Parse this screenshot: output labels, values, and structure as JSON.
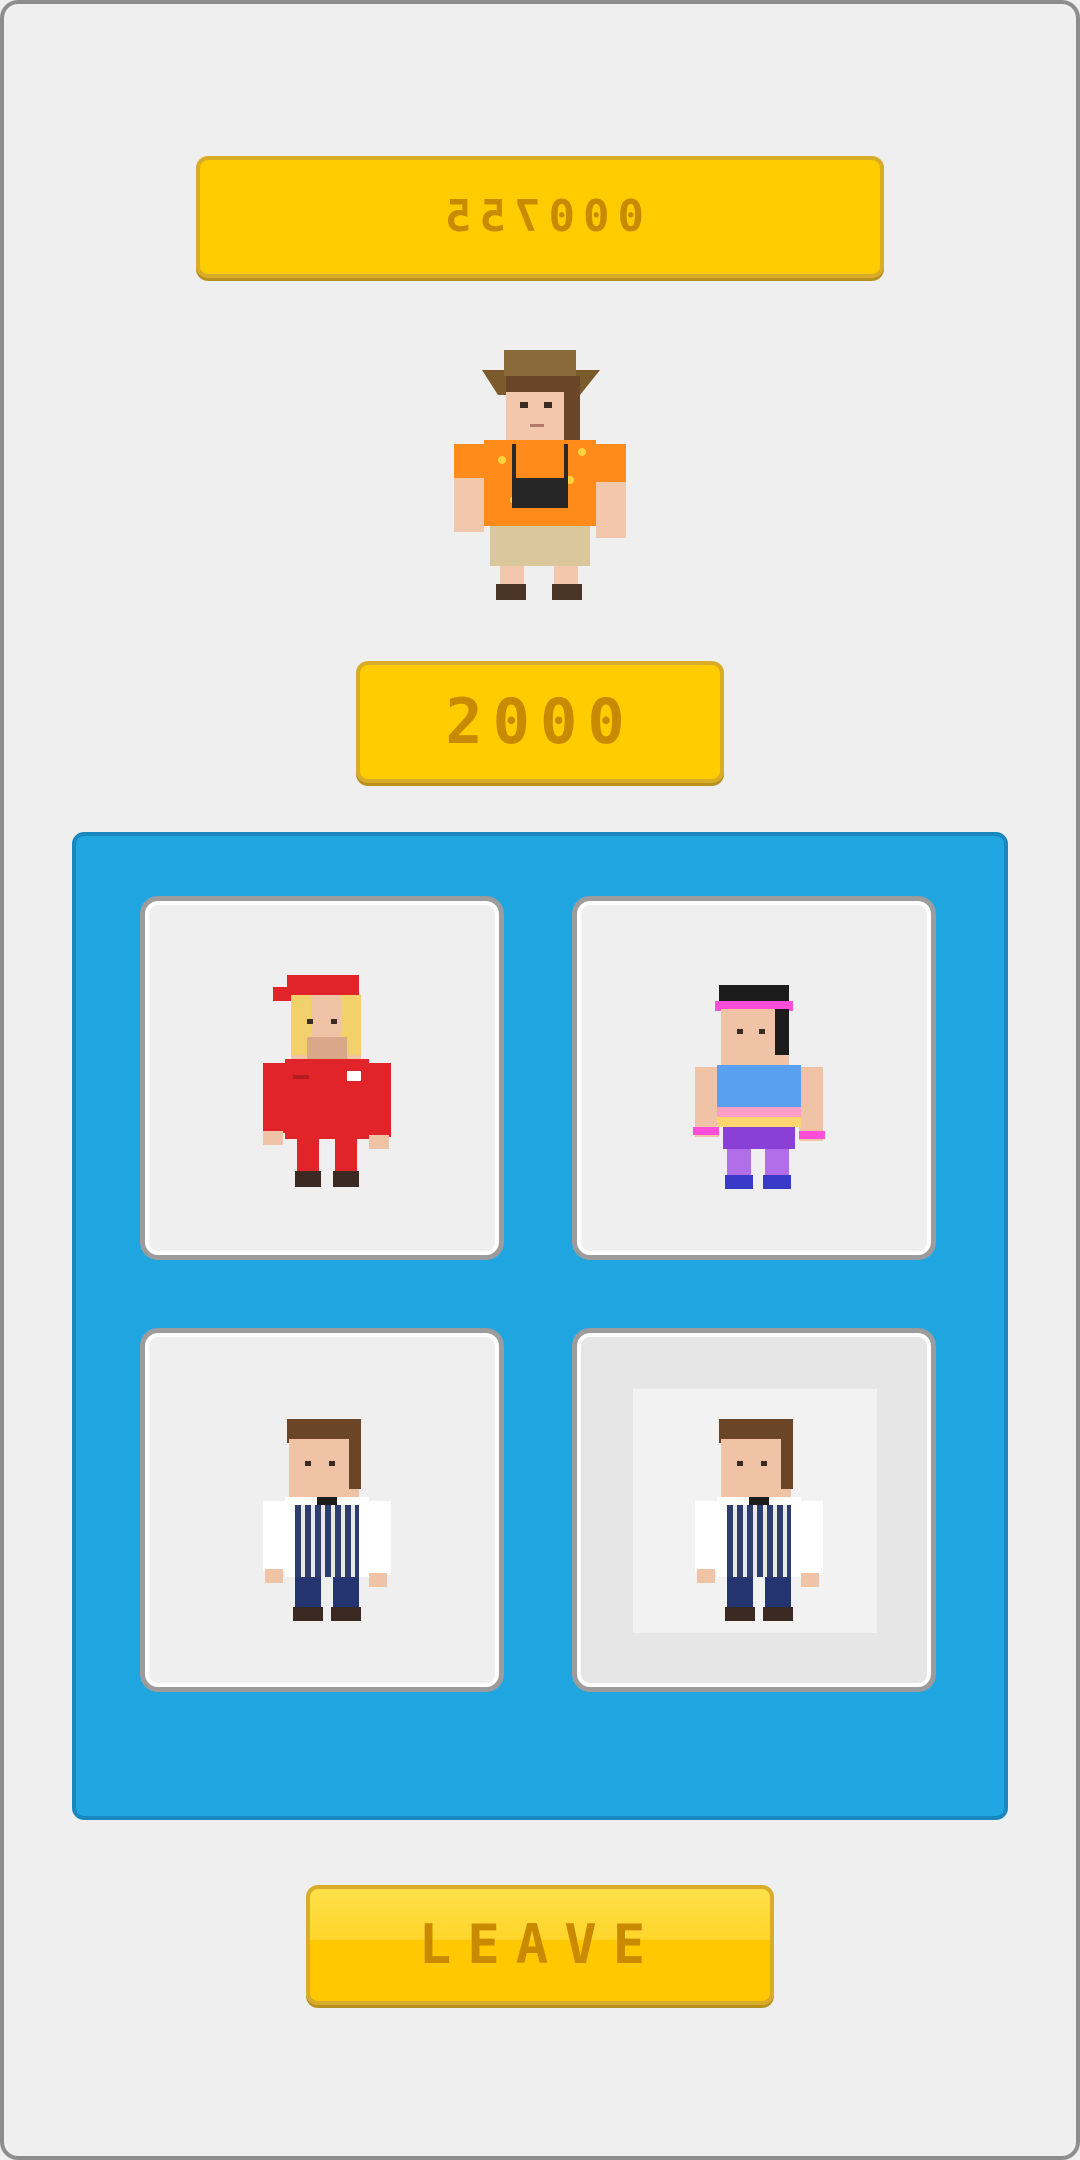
{
  "hud": {
    "score_text": "000755"
  },
  "shop": {
    "price_text": "2000",
    "leave_label": "LEAVE",
    "featured_character": "tourist-character",
    "slots": [
      {
        "character": "racer-character",
        "selected": false
      },
      {
        "character": "athlete-character",
        "selected": false
      },
      {
        "character": "butcher-character",
        "selected": false
      },
      {
        "character": "butcher-character",
        "selected": true
      }
    ]
  },
  "colors": {
    "background": "#efefef",
    "button_yellow": "#ffcc00",
    "button_text": "#c98a00",
    "panel_blue": "#1fa6e0"
  }
}
